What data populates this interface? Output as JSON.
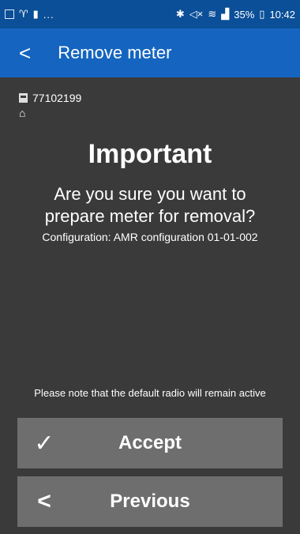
{
  "status_bar": {
    "left_icons": [
      "image-icon",
      "signal-icon",
      "person-icon"
    ],
    "more": "...",
    "right_icons": [
      "bluetooth-icon",
      "mute-icon",
      "wifi-icon",
      "signal-bars-icon"
    ],
    "battery": "35%",
    "time": "10:42"
  },
  "app_bar": {
    "back_icon": "chevron-left-icon",
    "title": "Remove meter"
  },
  "meter": {
    "id": "77102199",
    "meter_icon": "meter-icon",
    "home_icon": "home-icon"
  },
  "dialog": {
    "headline": "Important",
    "question": "Are you sure you want to prepare meter for removal?",
    "configuration": "Configuration: AMR configuration 01-01-002"
  },
  "note": "Please note that the default radio will remain active",
  "buttons": {
    "accept": {
      "label": "Accept",
      "icon": "checkmark-icon"
    },
    "previous": {
      "label": "Previous",
      "icon": "chevron-left-icon"
    }
  }
}
